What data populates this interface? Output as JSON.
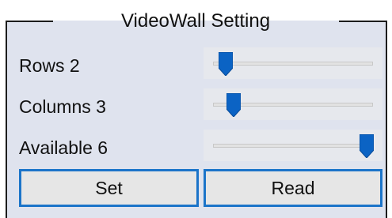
{
  "group": {
    "title": "VideoWall Setting"
  },
  "rows": {
    "label": "Rows 2",
    "value": 2,
    "slider_fraction": 0.08
  },
  "columns": {
    "label": "Columns 3",
    "value": 3,
    "slider_fraction": 0.13
  },
  "available": {
    "label": "Available 6",
    "value": 6,
    "slider_fraction": 0.96
  },
  "buttons": {
    "set_label": "Set",
    "read_label": "Read"
  },
  "colors": {
    "panel_background": "#dfe3ee",
    "slider_thumb": "#0b63c4",
    "button_border": "#1b74c9"
  },
  "icons": {
    "slider_thumb": "pointed-slider-thumb-icon"
  }
}
